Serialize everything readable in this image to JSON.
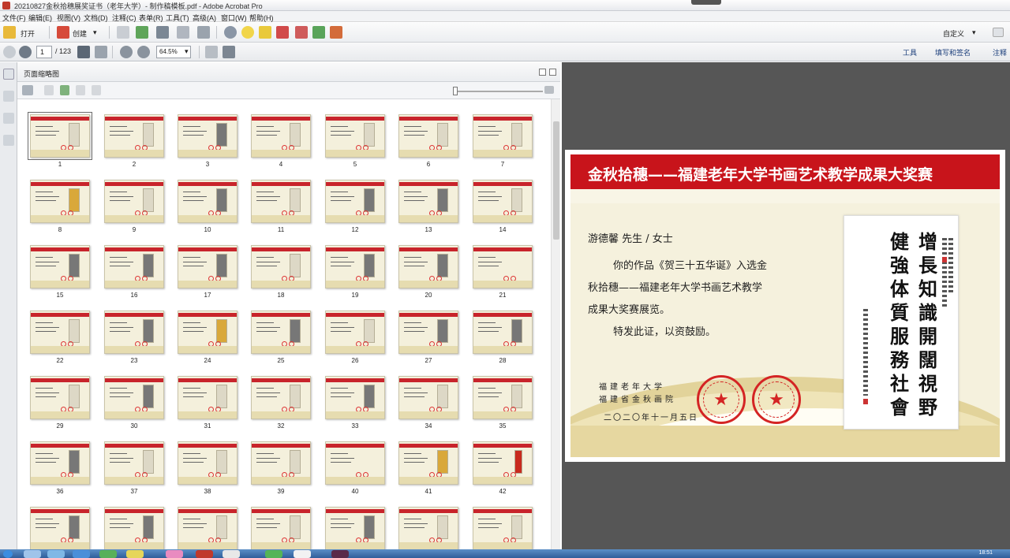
{
  "window": {
    "title": "20210827金秋拾穗展奖证书（老年大学）- 制作稿模板.pdf - Adobe Acrobat Pro"
  },
  "menu": [
    "文件(F)",
    "编辑(E)",
    "视图(V)",
    "文档(D)",
    "注释(C)",
    "表单(R)",
    "工具(T)",
    "高级(A)",
    "窗口(W)",
    "帮助(H)"
  ],
  "toolbar": {
    "open_label": "打开",
    "create_label": "创建",
    "customize_label": "自定义"
  },
  "nav": {
    "current_page": "1",
    "total_pages": "/ 123",
    "zoom": "64.5%",
    "tools_label": "工具",
    "sign_label": "填写和签名",
    "comment_label": "注释"
  },
  "panel": {
    "title": "页面缩略图"
  },
  "thumbnails": [
    {
      "n": "1",
      "art": "plain"
    },
    {
      "n": "2",
      "art": "plain"
    },
    {
      "n": "3",
      "art": "dark"
    },
    {
      "n": "4",
      "art": "plain"
    },
    {
      "n": "5",
      "art": "plain"
    },
    {
      "n": "6",
      "art": "plain"
    },
    {
      "n": "7",
      "art": "plain"
    },
    {
      "n": "8",
      "art": "gold"
    },
    {
      "n": "9",
      "art": "plain"
    },
    {
      "n": "10",
      "art": "dark"
    },
    {
      "n": "11",
      "art": "plain"
    },
    {
      "n": "12",
      "art": "dark"
    },
    {
      "n": "13",
      "art": "dark"
    },
    {
      "n": "14",
      "art": "plain"
    },
    {
      "n": "15",
      "art": "dark"
    },
    {
      "n": "16",
      "art": "dark"
    },
    {
      "n": "17",
      "art": "dark"
    },
    {
      "n": "18",
      "art": "plain"
    },
    {
      "n": "19",
      "art": "dark"
    },
    {
      "n": "20",
      "art": "dark"
    },
    {
      "n": "21",
      "art": "none"
    },
    {
      "n": "22",
      "art": "plain"
    },
    {
      "n": "23",
      "art": "dark"
    },
    {
      "n": "24",
      "art": "gold"
    },
    {
      "n": "25",
      "art": "dark"
    },
    {
      "n": "26",
      "art": "plain"
    },
    {
      "n": "27",
      "art": "dark"
    },
    {
      "n": "28",
      "art": "dark"
    },
    {
      "n": "29",
      "art": "plain"
    },
    {
      "n": "30",
      "art": "dark"
    },
    {
      "n": "31",
      "art": "plain"
    },
    {
      "n": "32",
      "art": "plain"
    },
    {
      "n": "33",
      "art": "dark"
    },
    {
      "n": "34",
      "art": "plain"
    },
    {
      "n": "35",
      "art": "plain"
    },
    {
      "n": "36",
      "art": "dark"
    },
    {
      "n": "37",
      "art": "plain"
    },
    {
      "n": "38",
      "art": "plain"
    },
    {
      "n": "39",
      "art": "plain"
    },
    {
      "n": "40",
      "art": "none"
    },
    {
      "n": "41",
      "art": "gold"
    },
    {
      "n": "42",
      "art": "red"
    },
    {
      "n": "",
      "art": "dark"
    },
    {
      "n": "",
      "art": "dark"
    },
    {
      "n": "",
      "art": "plain"
    },
    {
      "n": "",
      "art": "plain"
    },
    {
      "n": "",
      "art": "dark"
    },
    {
      "n": "",
      "art": "plain"
    },
    {
      "n": "",
      "art": "plain"
    }
  ],
  "certificate": {
    "banner": "金秋拾穗——福建老年大学书画艺术教学成果大奖赛",
    "recipient": "游德馨  先生 / 女士",
    "body_line1": "你的作品《贺三十五华诞》入选金",
    "body_line2": "秋拾穗——福建老年大学书画艺术教学",
    "body_line3": "成果大奖赛展览。",
    "body_line4": "特发此证，以资鼓励。",
    "org1": "福建老年大学",
    "org2": "福建省金秋画院",
    "date": "二〇二〇年十一月五日",
    "calligraphy_col1": "增長知識開闊視野",
    "calligraphy_col2": "健強体質服務社會"
  },
  "taskbar": {
    "clock": "18:51"
  },
  "colors": {
    "banner_red": "#c8141b",
    "seal_red": "#d42424",
    "cert_bg": "#f5f1dd",
    "doc_bg": "#565656"
  }
}
